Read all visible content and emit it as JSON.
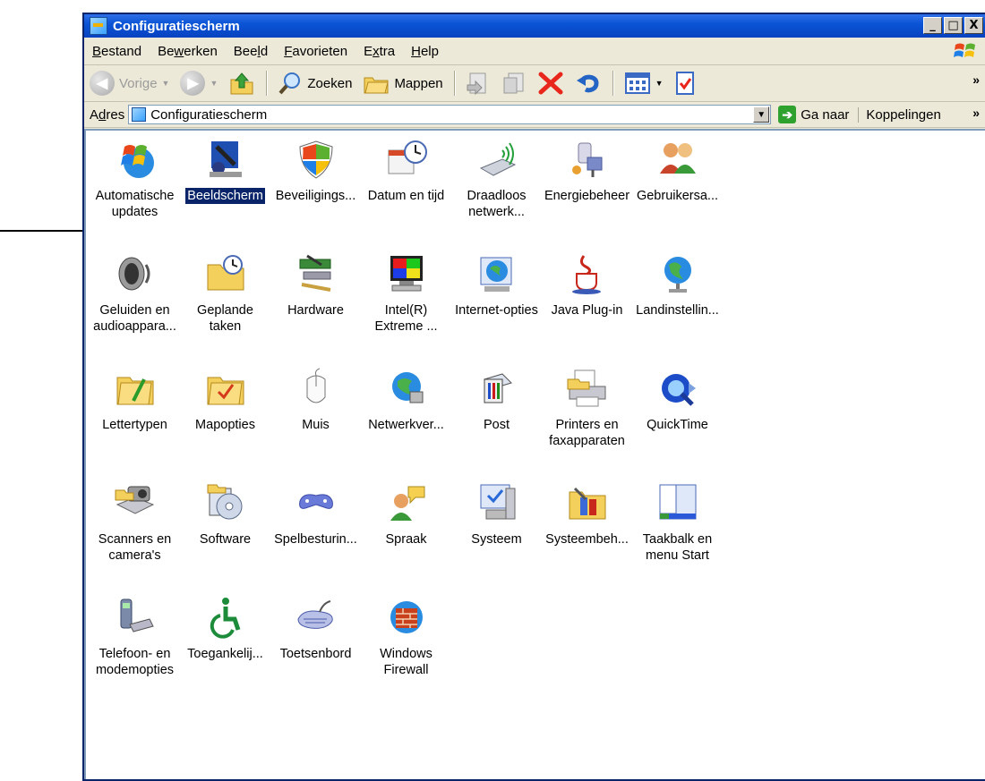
{
  "window": {
    "title": "Configuratiescherm",
    "controls": [
      "_",
      "□",
      "X"
    ]
  },
  "menu": [
    {
      "pre": "",
      "u": "B",
      "post": "estand"
    },
    {
      "pre": "Be",
      "u": "w",
      "post": "erken"
    },
    {
      "pre": "Bee",
      "u": "l",
      "post": "d"
    },
    {
      "pre": "",
      "u": "F",
      "post": "avorieten"
    },
    {
      "pre": "E",
      "u": "x",
      "post": "tra"
    },
    {
      "pre": "",
      "u": "H",
      "post": "elp"
    }
  ],
  "toolbar": {
    "back": "Vorige",
    "search": "Zoeken",
    "folders": "Mappen",
    "more": "»"
  },
  "address": {
    "label": "Adres",
    "label_u": "d",
    "value": "Configuratiescherm",
    "go": "Ga naar",
    "links": "Koppelingen",
    "more": "»"
  },
  "items": [
    {
      "line1": "Automatische",
      "line2": "updates",
      "icon": "windows-update-icon",
      "selected": false
    },
    {
      "line1": "Beeldscherm",
      "line2": "",
      "icon": "display-icon",
      "selected": true
    },
    {
      "line1": "Beveiligings...",
      "line2": "",
      "icon": "security-shield-icon",
      "selected": false
    },
    {
      "line1": "Datum en tijd",
      "line2": "",
      "icon": "calendar-clock-icon",
      "selected": false
    },
    {
      "line1": "Draadloos",
      "line2": "netwerk...",
      "icon": "wireless-network-icon",
      "selected": false
    },
    {
      "line1": "Energiebeheer",
      "line2": "",
      "icon": "power-plug-icon",
      "selected": false
    },
    {
      "line1": "Gebruikersa...",
      "line2": "",
      "icon": "users-icon",
      "selected": false
    },
    {
      "line1": "Geluiden en",
      "line2": "audioappara...",
      "icon": "speaker-icon",
      "selected": false
    },
    {
      "line1": "Geplande",
      "line2": "taken",
      "icon": "scheduled-tasks-icon",
      "selected": false
    },
    {
      "line1": "Hardware",
      "line2": "",
      "icon": "hardware-icon",
      "selected": false
    },
    {
      "line1": "Intel(R)",
      "line2": "Extreme ...",
      "icon": "monitor-color-icon",
      "selected": false
    },
    {
      "line1": "Internet-opties",
      "line2": "",
      "icon": "internet-globe-icon",
      "selected": false
    },
    {
      "line1": "Java Plug-in",
      "line2": "",
      "icon": "java-cup-icon",
      "selected": false
    },
    {
      "line1": "Landinstellin...",
      "line2": "",
      "icon": "globe-icon",
      "selected": false
    },
    {
      "line1": "Lettertypen",
      "line2": "",
      "icon": "fonts-folder-icon",
      "selected": false
    },
    {
      "line1": "Mapopties",
      "line2": "",
      "icon": "folder-options-icon",
      "selected": false
    },
    {
      "line1": "Muis",
      "line2": "",
      "icon": "mouse-icon",
      "selected": false
    },
    {
      "line1": "Netwerkver...",
      "line2": "",
      "icon": "network-globe-icon",
      "selected": false
    },
    {
      "line1": "Post",
      "line2": "",
      "icon": "mail-icon",
      "selected": false
    },
    {
      "line1": "Printers en",
      "line2": "faxapparaten",
      "icon": "printer-icon",
      "selected": false
    },
    {
      "line1": "QuickTime",
      "line2": "",
      "icon": "quicktime-icon",
      "selected": false
    },
    {
      "line1": "Scanners en",
      "line2": "camera's",
      "icon": "scanner-camera-icon",
      "selected": false
    },
    {
      "line1": "Software",
      "line2": "",
      "icon": "software-cd-icon",
      "selected": false
    },
    {
      "line1": "Spelbesturin...",
      "line2": "",
      "icon": "gamepad-icon",
      "selected": false
    },
    {
      "line1": "Spraak",
      "line2": "",
      "icon": "speech-icon",
      "selected": false
    },
    {
      "line1": "Systeem",
      "line2": "",
      "icon": "system-computer-icon",
      "selected": false
    },
    {
      "line1": "Systeembeh...",
      "line2": "",
      "icon": "admin-tools-icon",
      "selected": false
    },
    {
      "line1": "Taakbalk en",
      "line2": "menu Start",
      "icon": "taskbar-icon",
      "selected": false
    },
    {
      "line1": "Telefoon- en",
      "line2": "modemopties",
      "icon": "phone-modem-icon",
      "selected": false
    },
    {
      "line1": "Toegankelij...",
      "line2": "",
      "icon": "accessibility-icon",
      "selected": false
    },
    {
      "line1": "Toetsenbord",
      "line2": "",
      "icon": "keyboard-icon",
      "selected": false
    },
    {
      "line1": "Windows",
      "line2": "Firewall",
      "icon": "firewall-icon",
      "selected": false
    }
  ]
}
